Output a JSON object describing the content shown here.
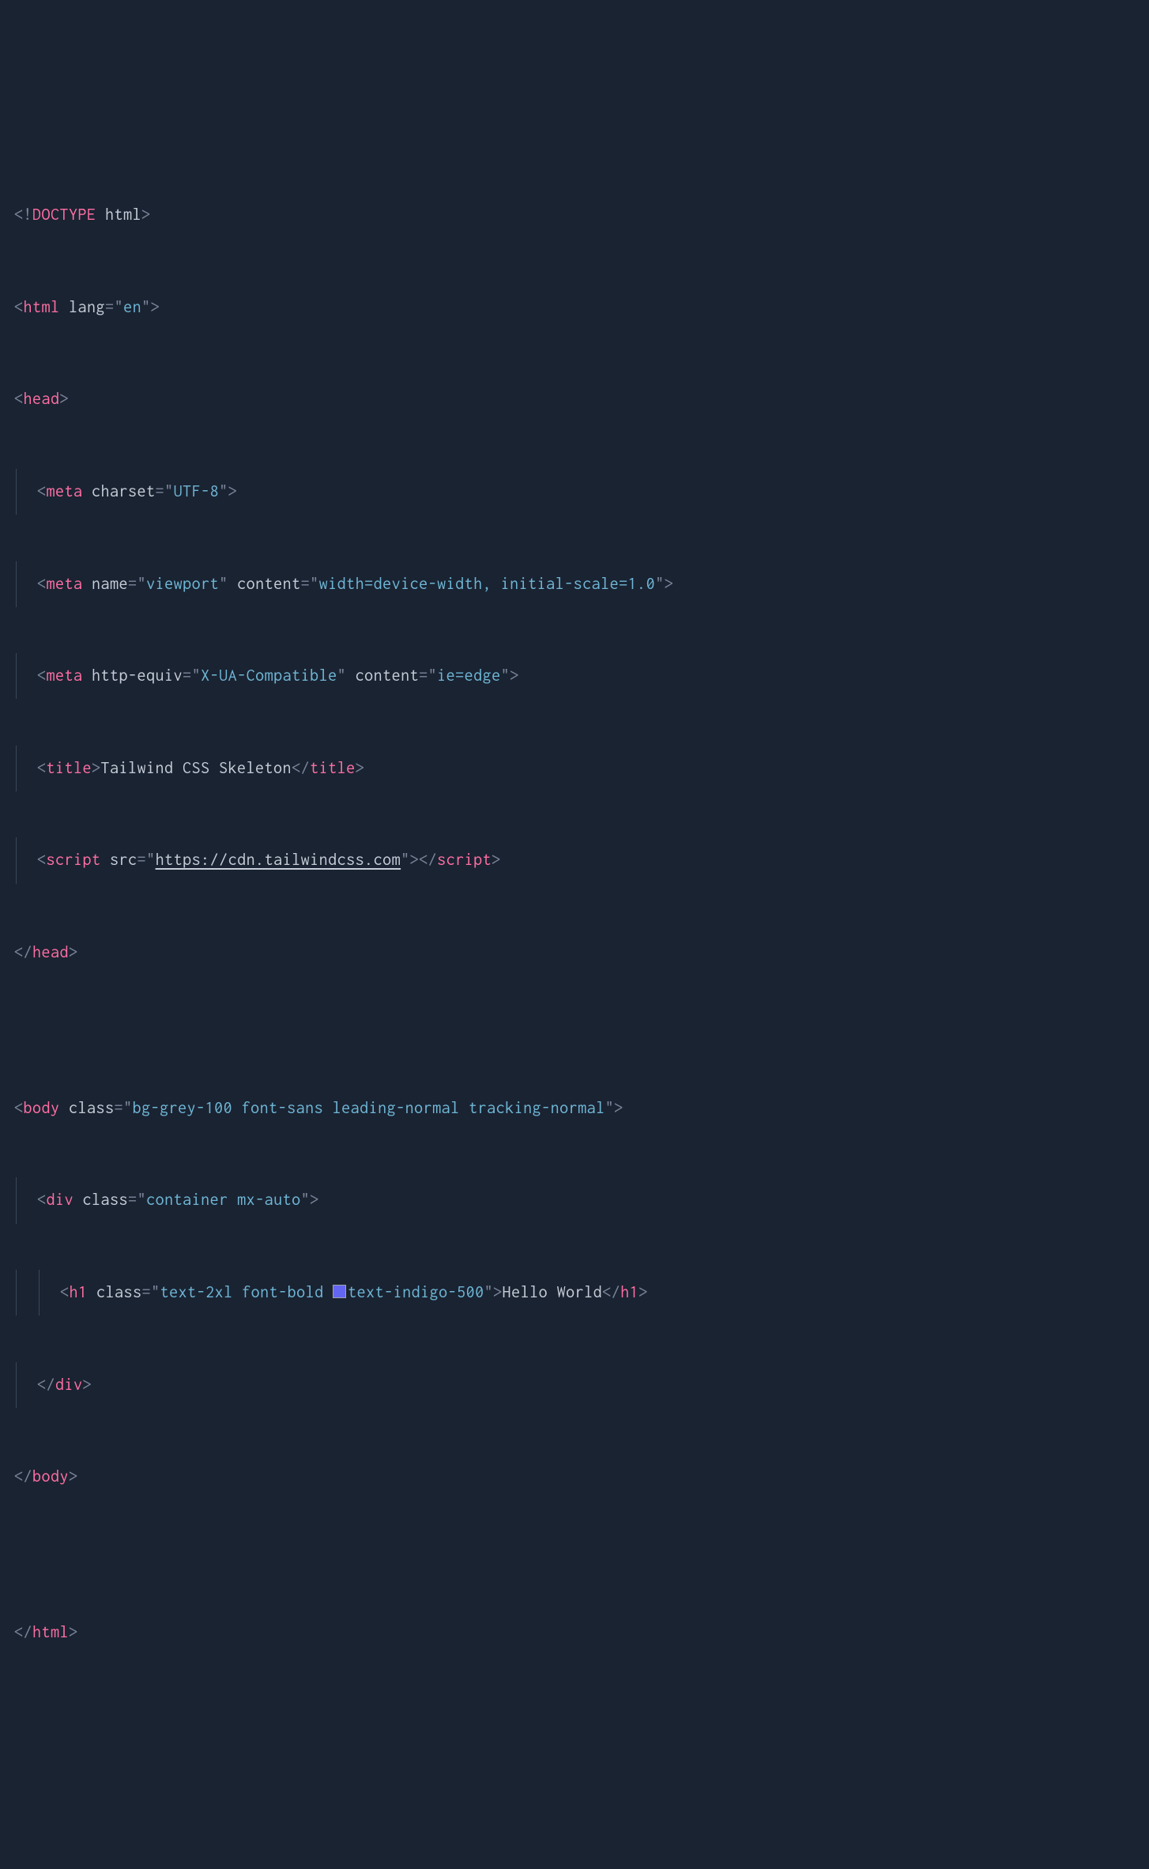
{
  "line1": {
    "open": "<!",
    "doctype": "DOCTYPE",
    "rest": " html",
    "close": ">"
  },
  "line2": {
    "open": "<",
    "tag": "html",
    "attr": " lang",
    "eq": "=",
    "q1": "\"",
    "val": "en",
    "q2": "\"",
    "close": ">"
  },
  "line3": {
    "open": "<",
    "tag": "head",
    "close": ">"
  },
  "line4": {
    "open": "<",
    "tag": "meta",
    "attr": " charset",
    "eq": "=",
    "q1": "\"",
    "val": "UTF-8",
    "q2": "\"",
    "close": ">"
  },
  "line5": {
    "open": "<",
    "tag": "meta",
    "attr1": " name",
    "eq1": "=",
    "q1a": "\"",
    "val1": "viewport",
    "q1b": "\"",
    "attr2": " content",
    "eq2": "=",
    "q2a": "\"",
    "val2": "width=device-width, initial-scale=1.0",
    "q2b": "\"",
    "close": ">"
  },
  "line6": {
    "open": "<",
    "tag": "meta",
    "attr1": " http-equiv",
    "eq1": "=",
    "q1a": "\"",
    "val1": "X-UA-Compatible",
    "q1b": "\"",
    "attr2": " content",
    "eq2": "=",
    "q2a": "\"",
    "val2": "ie=edge",
    "q2b": "\"",
    "close": ">"
  },
  "line7": {
    "open": "<",
    "tag": "title",
    "close": ">",
    "content": "Tailwind CSS Skeleton",
    "copen": "</",
    "ctag": "title",
    "cclose": ">"
  },
  "line8": {
    "open": "<",
    "tag": "script",
    "attr": " src",
    "eq": "=",
    "q1": "\"",
    "val": "https://cdn.tailwindcss.com",
    "q2": "\"",
    "close": ">",
    "copen": "</",
    "ctag": "script",
    "cclose": ">"
  },
  "line9": {
    "open": "</",
    "tag": "head",
    "close": ">"
  },
  "line10": {
    "open": "<",
    "tag": "body",
    "attr": " class",
    "eq": "=",
    "q1": "\"",
    "val": "bg-grey-100 font-sans leading-normal tracking-normal",
    "q2": "\"",
    "close": ">"
  },
  "line11": {
    "open": "<",
    "tag": "div",
    "attr": " class",
    "eq": "=",
    "q1": "\"",
    "val": "container mx-auto",
    "q2": "\"",
    "close": ">"
  },
  "line12": {
    "open": "<",
    "tag": "h1",
    "attr": " class",
    "eq": "=",
    "q1": "\"",
    "val1": "text-2xl font-bold ",
    "val2": "text-indigo-500",
    "q2": "\"",
    "close": ">",
    "content": "Hello World",
    "copen": "</",
    "ctag": "h1",
    "cclose": ">"
  },
  "line13": {
    "open": "</",
    "tag": "div",
    "close": ">"
  },
  "line14": {
    "open": "</",
    "tag": "body",
    "close": ">"
  },
  "line15": {
    "open": "</",
    "tag": "html",
    "close": ">"
  },
  "swatch_color": "#6366f1"
}
